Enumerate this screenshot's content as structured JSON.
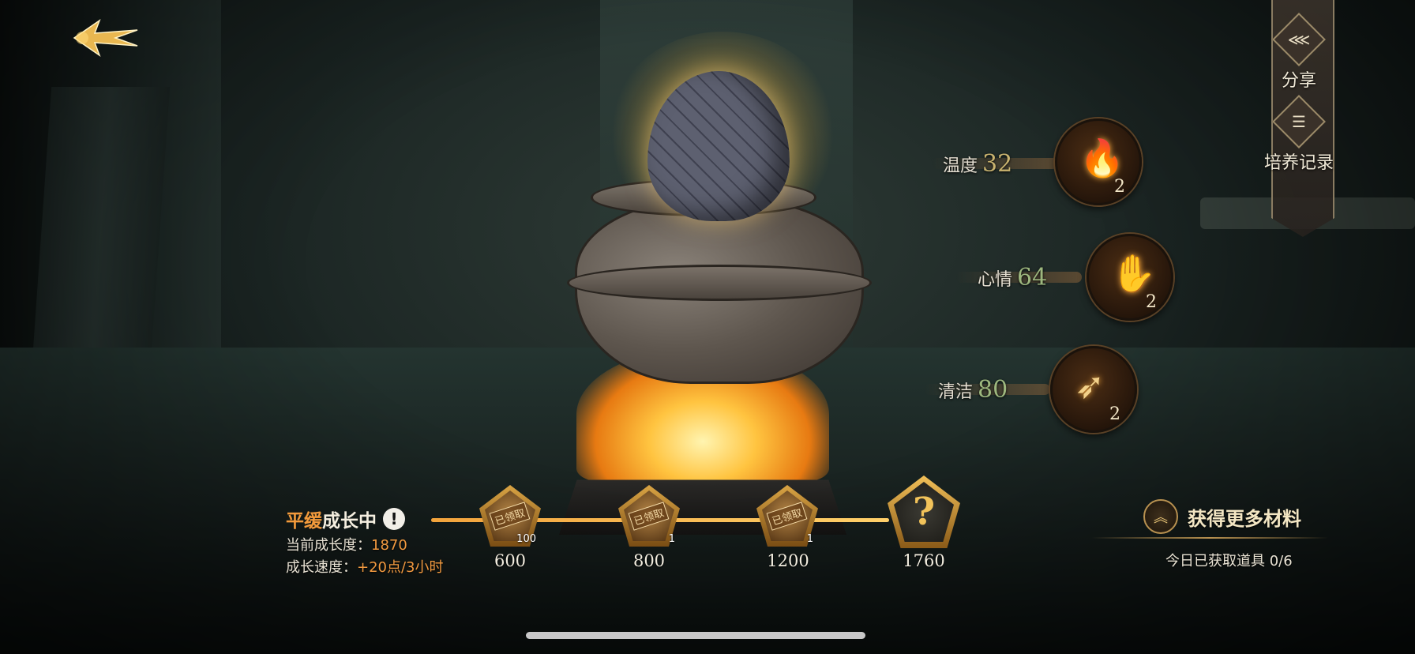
{
  "nav": {
    "back_icon": "winged-arrow-back-icon"
  },
  "menu": {
    "share": {
      "label": "分享",
      "icon": "share-icon"
    },
    "records": {
      "label": "培养记录",
      "icon": "scroll-icon"
    }
  },
  "stats": {
    "temperature": {
      "label": "温度",
      "value": "32",
      "item_count": "2",
      "icon": "flame-potion-icon"
    },
    "mood": {
      "label": "心情",
      "value": "64",
      "item_count": "2",
      "icon": "glove-icon"
    },
    "clean": {
      "label": "清洁",
      "value": "80",
      "item_count": "2",
      "icon": "brush-icon"
    }
  },
  "growth": {
    "status_highlight": "平缓",
    "status_rest": "成长中",
    "current_label": "当前成长度：",
    "current_value": "1870",
    "speed_label": "成长速度：",
    "speed_value": "+20点/3小时",
    "progress": 1.0,
    "rewards": [
      {
        "threshold": "600",
        "stamp": "已领取",
        "qty": "100",
        "claimed": true
      },
      {
        "threshold": "800",
        "stamp": "已领取",
        "qty": "1",
        "claimed": true
      },
      {
        "threshold": "1200",
        "stamp": "已领取",
        "qty": "1",
        "claimed": true
      },
      {
        "threshold": "1760",
        "symbol": "?",
        "mystery": true
      }
    ]
  },
  "materials": {
    "button_label": "获得更多材料",
    "today_text": "今日已获取道具 0/6"
  },
  "colors": {
    "accent": "#f29a40",
    "gold": "#c9b36f"
  }
}
